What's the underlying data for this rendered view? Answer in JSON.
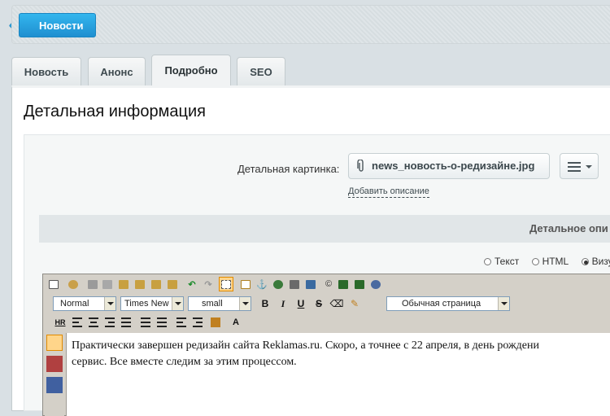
{
  "header": {
    "back_label": "Новости"
  },
  "tabs": [
    {
      "label": "Новость"
    },
    {
      "label": "Анонс"
    },
    {
      "label": "Подробно",
      "active": true
    },
    {
      "label": "SEO"
    }
  ],
  "panel": {
    "title": "Детальная информация",
    "picture_label": "Детальная картинка:",
    "file_name": "news_новость-о-редизайне.jpg",
    "add_description": "Добавить описание",
    "section_heading": "Детальное опи"
  },
  "mode": {
    "text": "Текст",
    "html": "HTML",
    "visual": "Визу",
    "selected": "visual"
  },
  "editor": {
    "format_value": "Normal",
    "font_value": "Times New",
    "size_value": "small",
    "template_value": "Обычная страница",
    "bold": "B",
    "italic": "I",
    "underline": "U",
    "strike": "S",
    "hr": "HR",
    "content_line1": "Практически завершен редизайн сайта Reklamas.ru.  Скоро, а точнее с 22 апреля, в день рождени",
    "content_line2": "сервис. Все вместе следим за этим процессом."
  },
  "colors": {
    "accent": "#1f8fd0",
    "toolbar": "#d4d0c8",
    "active_tool": "#ffd58a"
  }
}
